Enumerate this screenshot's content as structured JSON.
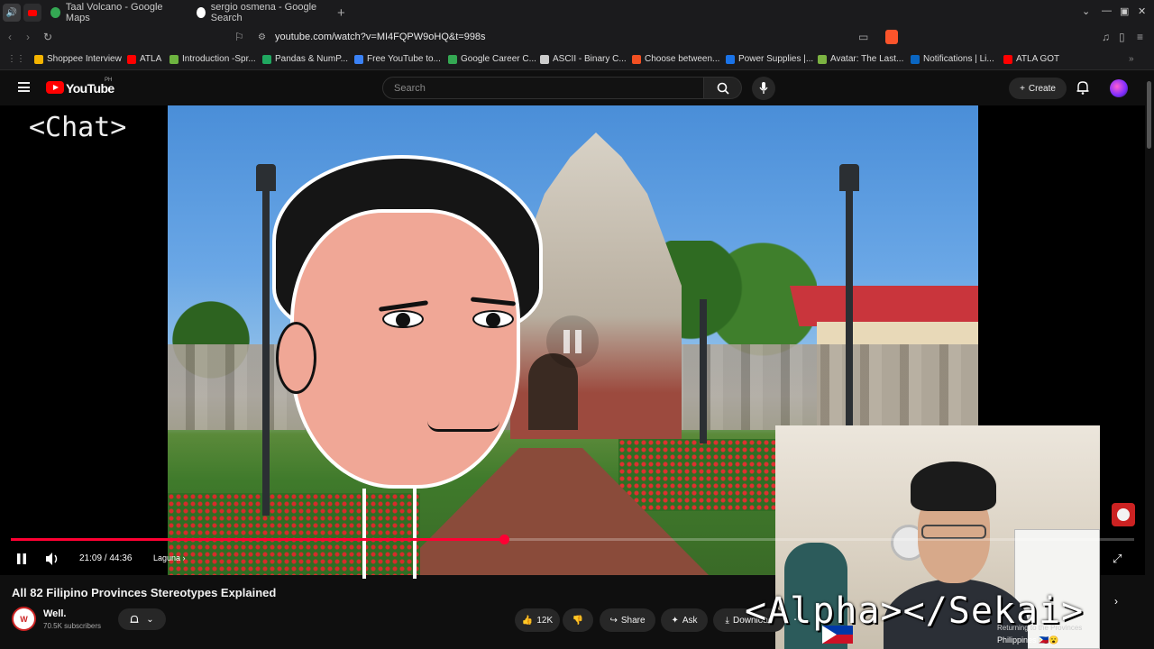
{
  "browser": {
    "tabs": [
      {
        "label": "Taal Volcano - Google Maps"
      },
      {
        "label": "sergio osmena - Google Search"
      }
    ],
    "url": "youtube.com/watch?v=MI4FQPW9oHQ&t=998s",
    "bookmarks": [
      {
        "label": "Shoppee Interview",
        "color": "#f5b400"
      },
      {
        "label": "ATLA",
        "color": "#ff0000"
      },
      {
        "label": "Introduction -Spr...",
        "color": "#6db33f"
      },
      {
        "label": "Pandas & NumP...",
        "color": "#20a860"
      },
      {
        "label": "Free YouTube to...",
        "color": "#3b82f6"
      },
      {
        "label": "Google Career C...",
        "color": "#34a853"
      },
      {
        "label": "ASCII - Binary C...",
        "color": "#cccccc"
      },
      {
        "label": "Choose between...",
        "color": "#f25022"
      },
      {
        "label": "Power Supplies |...",
        "color": "#1a73e8"
      },
      {
        "label": "Avatar: The Last...",
        "color": "#7cb342"
      },
      {
        "label": "Notifications | Li...",
        "color": "#0a66c2"
      },
      {
        "label": "ATLA GOT",
        "color": "#ff0000"
      }
    ]
  },
  "youtube": {
    "logo_text": "YouTube",
    "region": "PH",
    "search_placeholder": "Search",
    "create_label": "Create"
  },
  "player": {
    "overlay_chat": "<Chat>",
    "time": "21:09 / 44:36",
    "chapter": "Laguna",
    "progress_fraction": 0.439,
    "overlay_brand": "<Alpha></Sekai>",
    "caption_top": "Returning to the Provinces",
    "caption_bottom": "Philippines 🇵🇭😮"
  },
  "video": {
    "title": "All 82 Filipino Provinces Stereotypes Explained",
    "channel_name": "Well.",
    "channel_subs": "70.5K subscribers",
    "actions": {
      "likes": "12K",
      "share": "Share",
      "ask": "Ask",
      "download": "Download"
    }
  },
  "colors": {
    "accent": "#ff0033",
    "background": "#0f0f0f"
  }
}
